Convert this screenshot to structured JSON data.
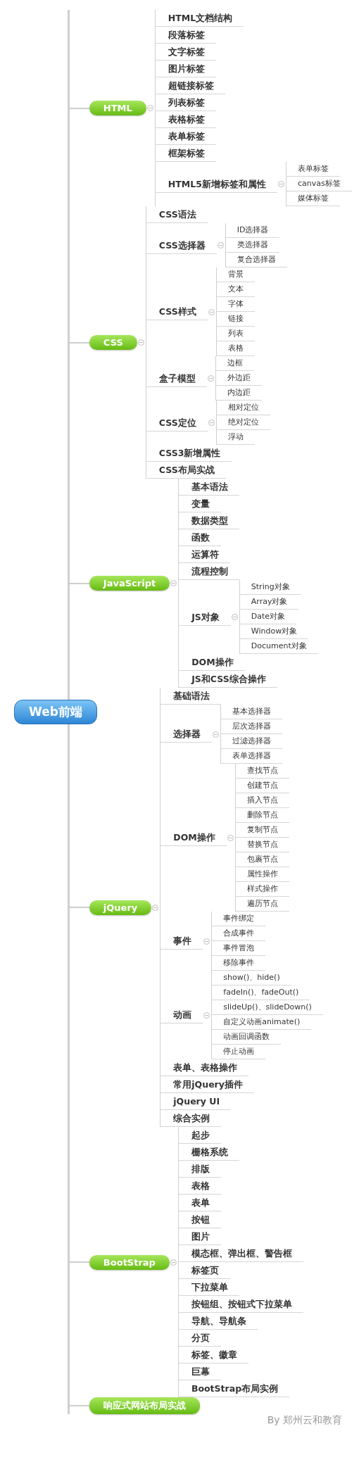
{
  "root": {
    "label": "Web前端"
  },
  "branches": [
    {
      "label": "HTML",
      "children": [
        {
          "label": "HTML文档结构"
        },
        {
          "label": "段落标签"
        },
        {
          "label": "文字标签"
        },
        {
          "label": "图片标签"
        },
        {
          "label": "超链接标签"
        },
        {
          "label": "列表标签"
        },
        {
          "label": "表格标签"
        },
        {
          "label": "表单标签"
        },
        {
          "label": "框架标签"
        },
        {
          "label": "HTML5新增标签和属性",
          "children": [
            {
              "label": "表单标签"
            },
            {
              "label": "canvas标签"
            },
            {
              "label": "媒体标签"
            }
          ]
        }
      ]
    },
    {
      "label": "CSS",
      "children": [
        {
          "label": "CSS语法"
        },
        {
          "label": "CSS选择器",
          "children": [
            {
              "label": "ID选择器"
            },
            {
              "label": "类选择器"
            },
            {
              "label": "复合选择器"
            }
          ]
        },
        {
          "label": "CSS样式",
          "children": [
            {
              "label": "背景"
            },
            {
              "label": "文本"
            },
            {
              "label": "字体"
            },
            {
              "label": "链接"
            },
            {
              "label": "列表"
            },
            {
              "label": "表格"
            }
          ]
        },
        {
          "label": "盒子模型",
          "children": [
            {
              "label": "边框"
            },
            {
              "label": "外边距"
            },
            {
              "label": "内边距"
            }
          ]
        },
        {
          "label": "CSS定位",
          "children": [
            {
              "label": "相对定位"
            },
            {
              "label": "绝对定位"
            },
            {
              "label": "浮动"
            }
          ]
        },
        {
          "label": "CSS3新增属性"
        },
        {
          "label": "CSS布局实战"
        }
      ]
    },
    {
      "label": "JavaScript",
      "children": [
        {
          "label": "基本语法"
        },
        {
          "label": "变量"
        },
        {
          "label": "数据类型"
        },
        {
          "label": "函数"
        },
        {
          "label": "运算符"
        },
        {
          "label": "流程控制"
        },
        {
          "label": "JS对象",
          "children": [
            {
              "label": "String对象"
            },
            {
              "label": "Array对象"
            },
            {
              "label": "Date对象"
            },
            {
              "label": "Window对象"
            },
            {
              "label": "Document对象"
            }
          ]
        },
        {
          "label": "DOM操作"
        },
        {
          "label": "JS和CSS综合操作"
        }
      ]
    },
    {
      "label": "jQuery",
      "children": [
        {
          "label": "基础语法"
        },
        {
          "label": "选择器",
          "children": [
            {
              "label": "基本选择器"
            },
            {
              "label": "层次选择器"
            },
            {
              "label": "过滤选择器"
            },
            {
              "label": "表单选择器"
            }
          ]
        },
        {
          "label": "DOM操作",
          "children": [
            {
              "label": "查找节点"
            },
            {
              "label": "创建节点"
            },
            {
              "label": "插入节点"
            },
            {
              "label": "删除节点"
            },
            {
              "label": "复制节点"
            },
            {
              "label": "替换节点"
            },
            {
              "label": "包裹节点"
            },
            {
              "label": "属性操作"
            },
            {
              "label": "样式操作"
            },
            {
              "label": "遍历节点"
            }
          ]
        },
        {
          "label": "事件",
          "children": [
            {
              "label": "事件绑定"
            },
            {
              "label": "合成事件"
            },
            {
              "label": "事件冒泡"
            },
            {
              "label": "移除事件"
            }
          ]
        },
        {
          "label": "动画",
          "children": [
            {
              "label": "show()、hide()"
            },
            {
              "label": "fadeIn()、fadeOut()"
            },
            {
              "label": "slideUp()、slideDown()"
            },
            {
              "label": "自定义动画animate()"
            },
            {
              "label": "动画回调函数"
            },
            {
              "label": "停止动画"
            }
          ]
        },
        {
          "label": "表单、表格操作"
        },
        {
          "label": "常用jQuery插件"
        },
        {
          "label": "jQuery UI"
        },
        {
          "label": "综合实例"
        }
      ]
    },
    {
      "label": "BootStrap",
      "children": [
        {
          "label": "起步"
        },
        {
          "label": "栅格系统"
        },
        {
          "label": "排版"
        },
        {
          "label": "表格"
        },
        {
          "label": "表单"
        },
        {
          "label": "按钮"
        },
        {
          "label": "图片"
        },
        {
          "label": "模态框、弹出框、警告框"
        },
        {
          "label": "标签页"
        },
        {
          "label": "下拉菜单"
        },
        {
          "label": "按钮组、按钮式下拉菜单"
        },
        {
          "label": "导航、导航条"
        },
        {
          "label": "分页"
        },
        {
          "label": "标签、徽章"
        },
        {
          "label": "巨幕"
        },
        {
          "label": "BootStrap布局实例"
        }
      ]
    },
    {
      "label": "响应式网站布局实战"
    }
  ],
  "credit": "By 郑州云和教育"
}
